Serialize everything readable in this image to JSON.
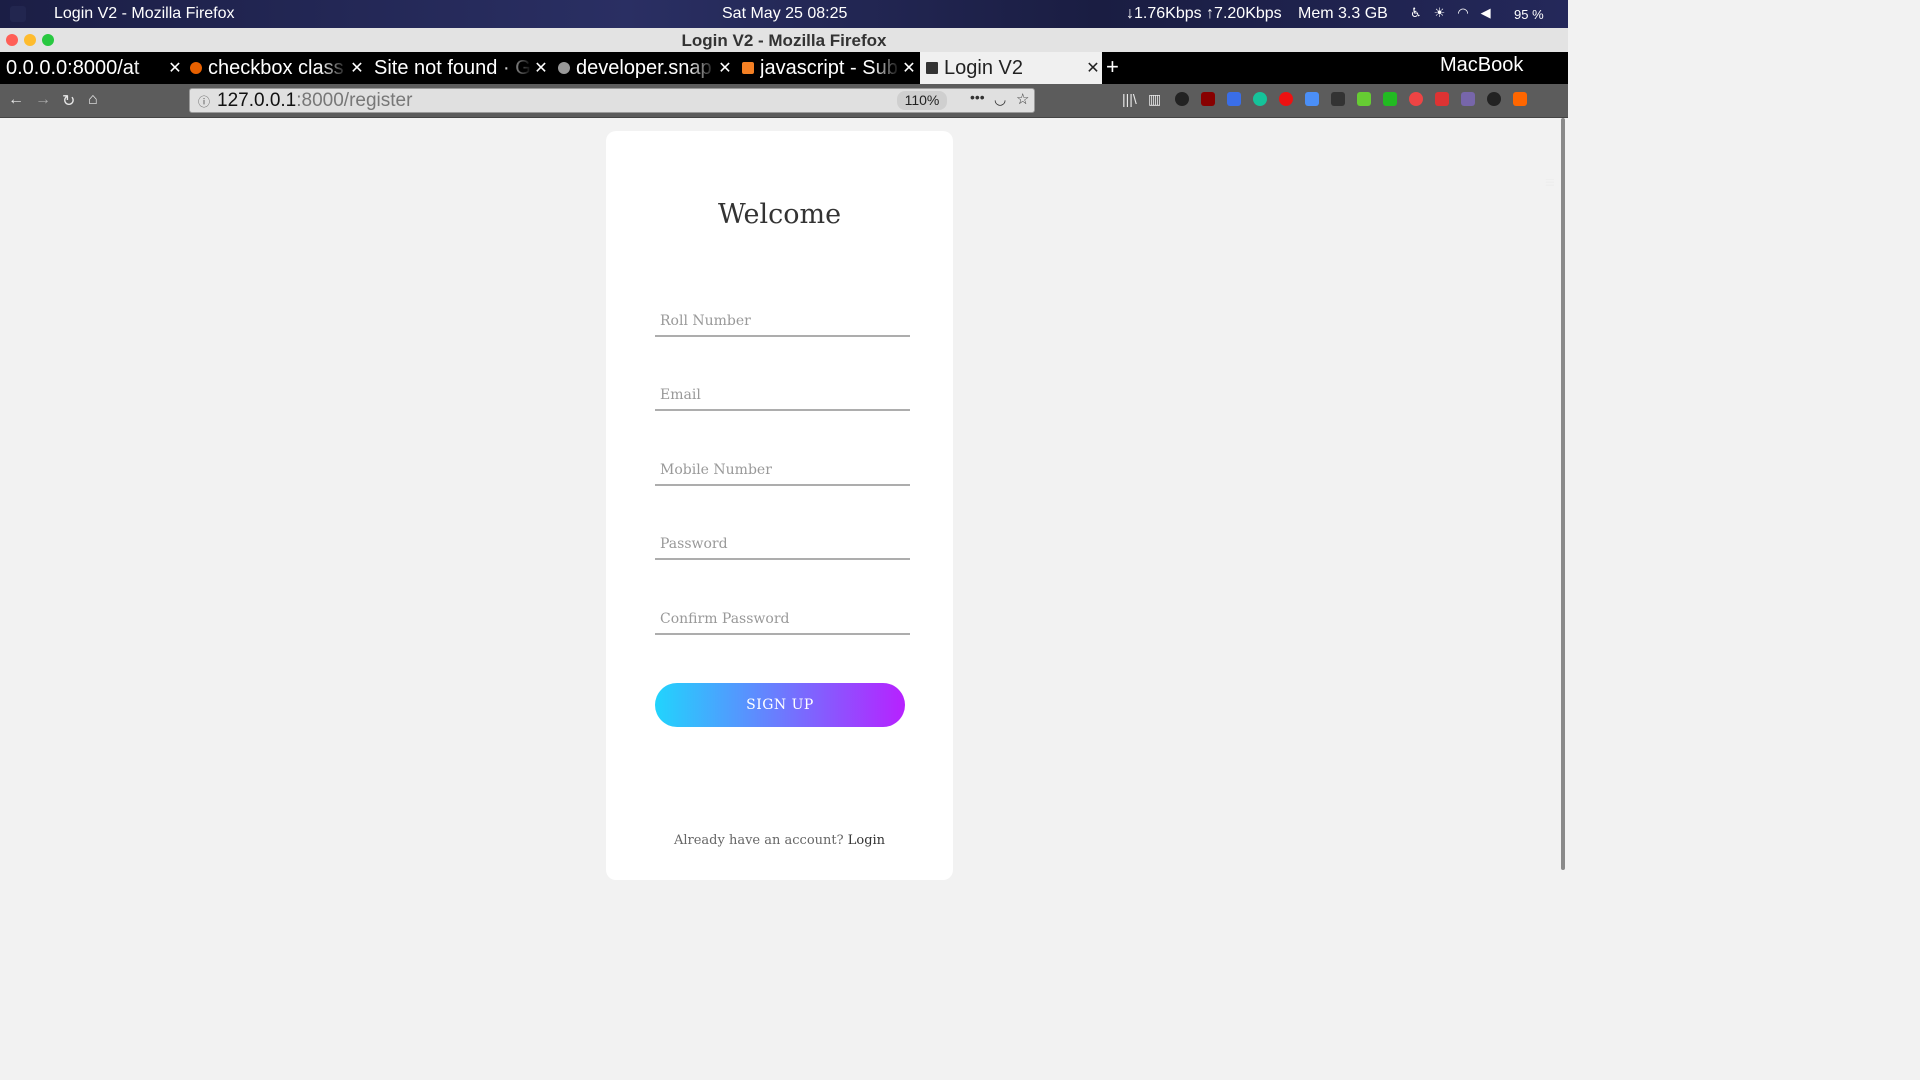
{
  "os_panel": {
    "app_title": "Login V2 - Mozilla Firefox",
    "clock": "Sat May 25  08:25",
    "network": "↓1.76Kbps ↑7.20Kbps",
    "memory": "Mem 3.3 GB",
    "battery": "95 %"
  },
  "window": {
    "title": "Login V2 - Mozilla Firefox"
  },
  "tabs": [
    {
      "label": "0.0.0.0:8000/at",
      "favicon_color": ""
    },
    {
      "label": "checkbox class",
      "favicon_color": "#e66000"
    },
    {
      "label": "Site not found · G",
      "favicon_color": ""
    },
    {
      "label": "developer.snap",
      "favicon_color": "#999999"
    },
    {
      "label": "javascript - Sub",
      "favicon_color": "#f48024"
    },
    {
      "label": "Login V2",
      "favicon_color": "#333333"
    }
  ],
  "toolbar": {
    "brand": "MacBook",
    "url_host": "127.0.0.1",
    "url_rest": ":8000/register",
    "zoom": "110%"
  },
  "form": {
    "title": "Welcome",
    "roll_placeholder": "Roll Number",
    "email_placeholder": "Email",
    "mobile_placeholder": "Mobile Number",
    "password_placeholder": "Password",
    "confirm_placeholder": "Confirm Password",
    "signup_label": "SIGN UP",
    "login_prompt": "Already have an account?",
    "login_link": "Login"
  },
  "colors": {
    "button_gradient_start": "#21d4fd",
    "button_gradient_end": "#b721ff",
    "page_bg": "#f2f2f2"
  }
}
